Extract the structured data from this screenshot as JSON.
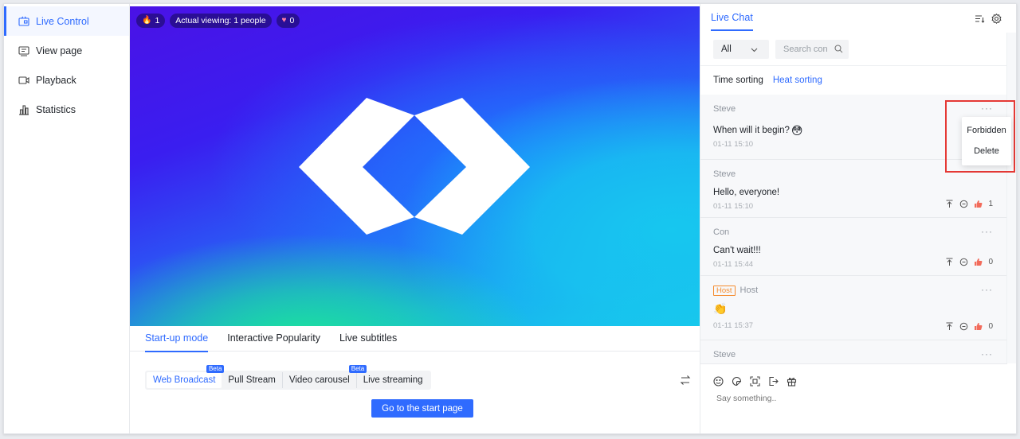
{
  "sidebar": {
    "items": [
      {
        "label": "Live Control",
        "icon": "live-control-icon",
        "active": true
      },
      {
        "label": "View page",
        "icon": "view-page-icon",
        "active": false
      },
      {
        "label": "Playback",
        "icon": "playback-icon",
        "active": false
      },
      {
        "label": "Statistics",
        "icon": "statistics-icon",
        "active": false
      }
    ]
  },
  "video": {
    "stats": {
      "popularity": "1",
      "viewing": "Actual viewing: 1 people",
      "likes": "0"
    }
  },
  "bottom_tabs": [
    "Start-up mode",
    "Interactive Popularity",
    "Live subtitles"
  ],
  "modes": {
    "items": [
      "Web Broadcast",
      "Pull Stream",
      "Video carousel",
      "Live streaming"
    ],
    "beta_label": "Beta"
  },
  "start_button": "Go to the start page",
  "chat": {
    "title": "Live Chat",
    "filter_value": "All",
    "search_placeholder": "Search con",
    "sort": {
      "time": "Time sorting",
      "heat": "Heat sorting"
    },
    "messages": [
      {
        "user": "Steve",
        "text": "When will it begin?",
        "emoji": "😳",
        "time": "01-11 15:10",
        "likes": ""
      },
      {
        "user": "Steve",
        "text": "Hello, everyone!",
        "time": "01-11 15:10",
        "likes": "1"
      },
      {
        "user": "Con",
        "text": "Can't wait!!!",
        "time": "01-11 15:44",
        "likes": "0"
      },
      {
        "user": "Host",
        "tag": "Host",
        "emoji": "👏",
        "time": "01-11 15:37",
        "likes": "0"
      },
      {
        "user": "Steve"
      }
    ],
    "more_label": "···",
    "menu": {
      "forbidden": "Forbidden",
      "delete": "Delete"
    },
    "composer_placeholder": "Say something.."
  },
  "colors": {
    "accent": "#2f6bff",
    "host_tag": "#f58b2d",
    "highlight_box": "#e53935"
  }
}
